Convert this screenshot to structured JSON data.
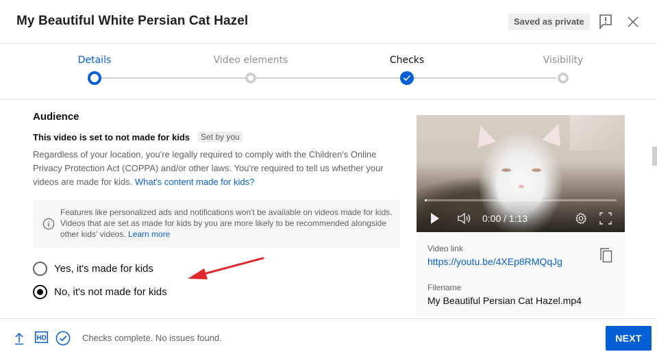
{
  "header": {
    "title": "My Beautiful White Persian Cat Hazel",
    "saved_status": "Saved as private",
    "feedback_icon": "feedback-exclamation-icon",
    "close_icon": "close-icon"
  },
  "stepper": {
    "steps": [
      {
        "label": "Details",
        "state": "active"
      },
      {
        "label": "Video elements",
        "state": "todo"
      },
      {
        "label": "Checks",
        "state": "done"
      },
      {
        "label": "Visibility",
        "state": "todo"
      }
    ]
  },
  "audience": {
    "title": "Audience",
    "status_text": "This video is set to not made for kids",
    "set_by_badge": "Set by you",
    "description": "Regardless of your location, you're legally required to comply with the Children's Online Privacy Protection Act (COPPA) and/or other laws. You're required to tell us whether your videos are made for kids.",
    "description_link": "What's content made for kids?",
    "info_text": "Features like personalized ads and notifications won't be available on videos made for kids. Videos that are set as made for kids by you are more likely to be recommended alongside other kids' videos.",
    "info_link": "Learn more",
    "options": [
      {
        "label": "Yes, it's made for kids",
        "checked": false
      },
      {
        "label": "No, it's not made for kids",
        "checked": true
      }
    ]
  },
  "video": {
    "current_time": "0:00",
    "duration": "1:13",
    "time_display": "0:00 / 1:13",
    "progress_fraction": 0.0,
    "link_label": "Video link",
    "link": "https://youtu.be/4XEp8RMQqJg",
    "filename_label": "Filename",
    "filename": "My Beautiful Persian Cat Hazel.mp4"
  },
  "footer": {
    "status_text": "Checks complete. No issues found.",
    "next_label": "NEXT"
  },
  "colors": {
    "accent": "#065fd4",
    "annotation_arrow": "#e0282d"
  }
}
